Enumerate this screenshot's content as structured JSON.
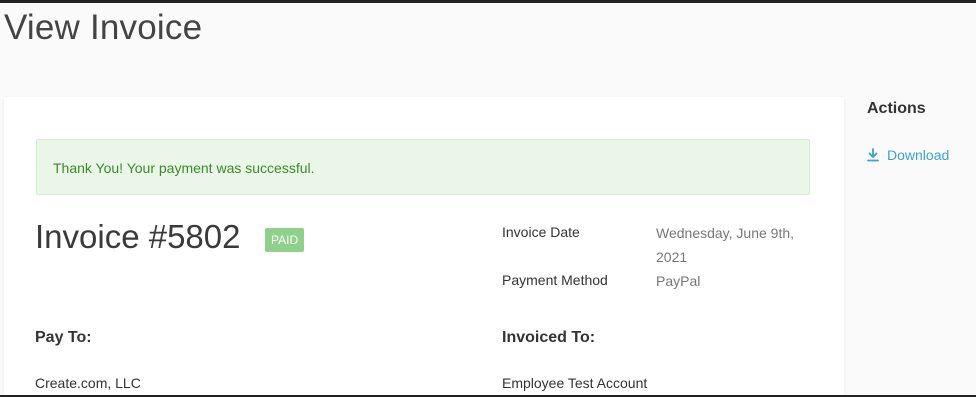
{
  "page": {
    "title": "View Invoice"
  },
  "alert": {
    "message": "Thank You! Your payment was successful."
  },
  "invoice": {
    "number_label": "Invoice #5802",
    "status": "PAID",
    "date_label": "Invoice Date",
    "date_value": "Wednesday, June 9th, 2021",
    "payment_method_label": "Payment Method",
    "payment_method_value": "PayPal"
  },
  "pay_to": {
    "heading": "Pay To:",
    "lines": [
      "Create.com, LLC"
    ]
  },
  "invoiced_to": {
    "heading": "Invoiced To:",
    "lines": [
      "Employee Test Account"
    ]
  },
  "actions": {
    "heading": "Actions",
    "download_label": "Download",
    "download_icon": "download-icon"
  },
  "colors": {
    "link": "#3aa1d8",
    "success_bg": "#eaf6e8",
    "success_text": "#3b8a2c",
    "paid_badge": "#8fd18a"
  }
}
